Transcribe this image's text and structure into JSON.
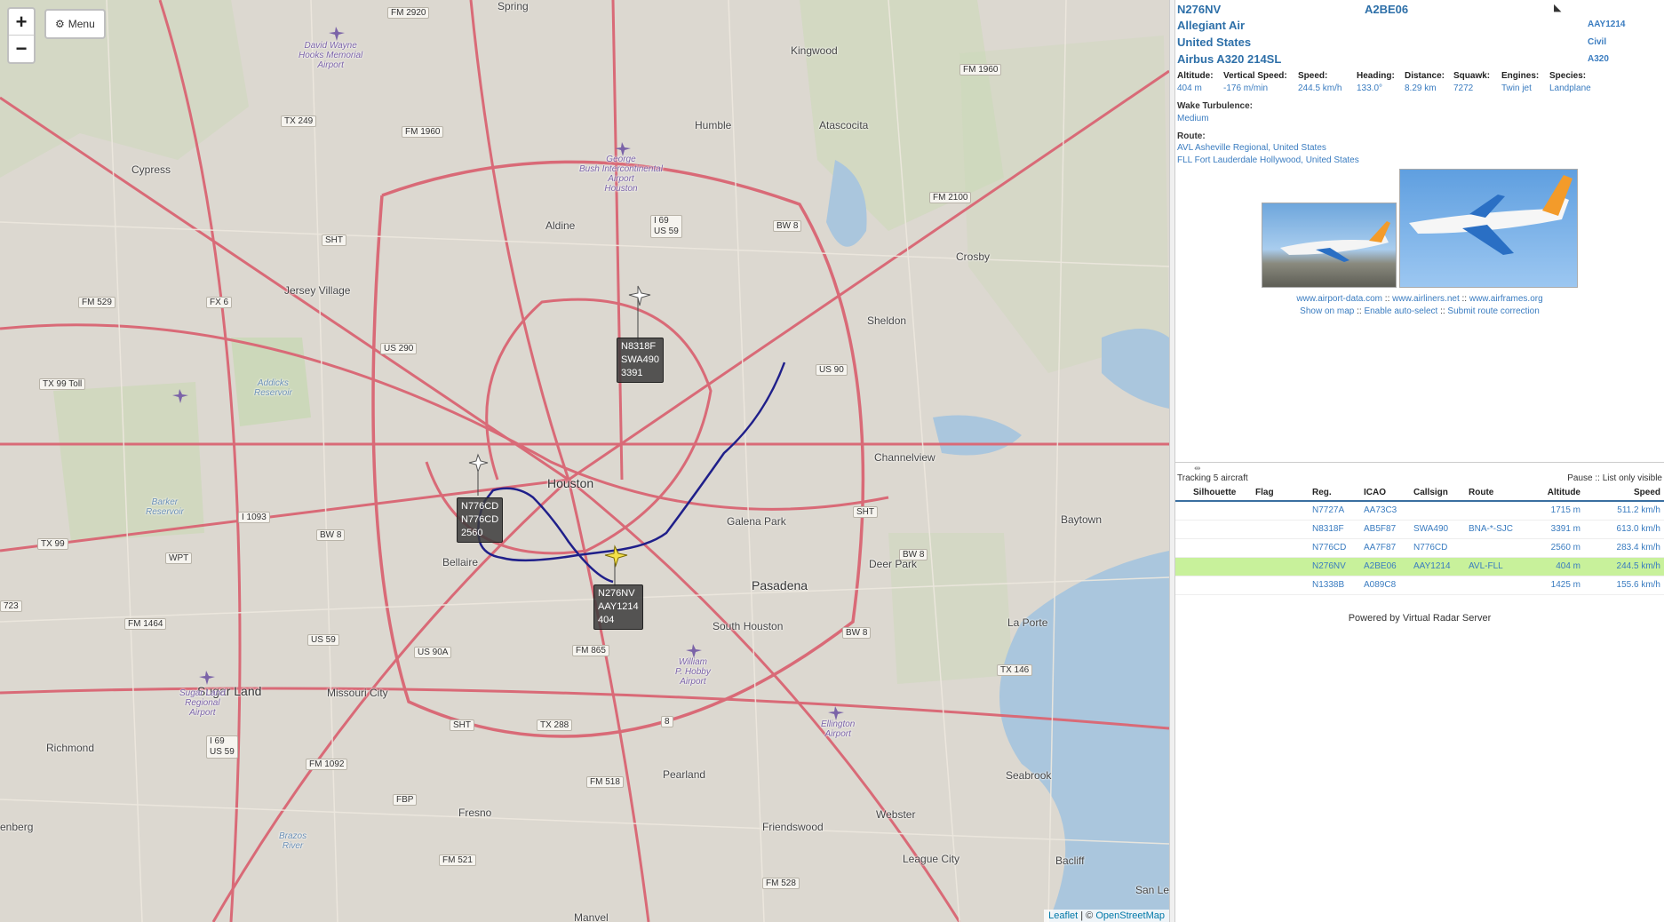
{
  "map": {
    "zoom_in": "+",
    "zoom_out": "−",
    "menu_label": "Menu",
    "attribution_leaflet": "Leaflet",
    "attribution_sep": " | © ",
    "attribution_osm": "OpenStreetMap",
    "places": {
      "houston": "Houston",
      "pasadena": "Pasadena",
      "sugar_land": "Sugar Land",
      "cypress": "Cypress",
      "jersey_village": "Jersey Village",
      "aldine": "Aldine",
      "humble": "Humble",
      "kingwood": "Kingwood",
      "atascocita": "Atascocita",
      "crosby": "Crosby",
      "sheldon": "Sheldon",
      "channelview": "Channelview",
      "galena_park": "Galena Park",
      "baytown": "Baytown",
      "deer_park": "Deer Park",
      "la_porte": "La Porte",
      "south_houston": "South Houston",
      "bellaire": "Bellaire",
      "missouri_city": "Missouri City",
      "richmond": "Richmond",
      "pearland": "Pearland",
      "fresno": "Fresno",
      "friendswood": "Friendswood",
      "webster": "Webster",
      "league_city": "League City",
      "seabrook": "Seabrook",
      "bacliff": "Bacliff",
      "spring": "Spring",
      "manvel": "Manvel",
      "san_leon": "San Leo",
      "enberg": "enberg"
    },
    "airports": {
      "hooks": "David Wayne\nHooks Memorial\nAirport",
      "iah": "George\nBush Intercontinental\nAirport\nHouston",
      "hobby": "William\nP. Hobby\nAirport",
      "ellington": "Ellington\nAirport",
      "sugar_land": "Sugar Land\nRegional\nAirport"
    },
    "water": {
      "addicks": "Addicks\nReservoir",
      "barker": "Barker\nReservoir",
      "brazos": "Brazos\nRiver"
    },
    "shields": [
      "FM 2920",
      "FM 1960",
      "TX 249",
      "FM 1960",
      "US 290",
      "FM 529",
      "FX 6",
      "TX 99 Toll",
      "SHT",
      "I 69\nUS 59",
      "BW 8",
      "US 90",
      "FM 2100",
      "SHT",
      "BW 8",
      "I 1093",
      "TX 99",
      "WPT",
      "BW 8",
      "US 59",
      "US 90A",
      "FM 1464",
      "FM 865",
      "SHT",
      "TX 288",
      "8",
      "FM 518",
      "FM 1092",
      "I 69\nUS 59",
      "FBP",
      "FM 521",
      "FM 528",
      "BW 8",
      "TX 146",
      "723"
    ],
    "aircraft_labels": [
      {
        "reg": "N8318F",
        "callsign": "SWA490",
        "alt": "3391"
      },
      {
        "reg": "N776CD",
        "callsign": "N776CD",
        "alt": "2560"
      },
      {
        "reg": "N276NV",
        "callsign": "AAY1214",
        "alt": "404"
      }
    ]
  },
  "detail": {
    "registration": "N276NV",
    "icao": "A2BE06",
    "operator": "Allegiant Air",
    "operator_code": "AAY1214",
    "country": "United States",
    "category": "Civil",
    "model": "Airbus A320 214SL",
    "model_code": "A320",
    "stats": [
      {
        "label": "Altitude:",
        "value": "404 m"
      },
      {
        "label": "Vertical Speed:",
        "value": "-176 m/min"
      },
      {
        "label": "Speed:",
        "value": "244.5 km/h"
      },
      {
        "label": "Heading:",
        "value": "133.0°"
      },
      {
        "label": "Distance:",
        "value": "8.29 km"
      },
      {
        "label": "Squawk:",
        "value": "7272"
      },
      {
        "label": "Engines:",
        "value": "Twin jet"
      },
      {
        "label": "Species:",
        "value": "Landplane"
      }
    ],
    "wake_label": "Wake Turbulence:",
    "wake_value": "Medium",
    "route_label": "Route:",
    "route_from": "AVL Asheville Regional, United States",
    "route_to": "FLL Fort Lauderdale Hollywood, United States",
    "links_line1": {
      "a": "www.airport-data.com",
      "sep1": " :: ",
      "b": "www.airliners.net",
      "sep2": " :: ",
      "c": "www.airframes.org"
    },
    "links_line2": {
      "a": "Show on map",
      "sep1": " :: ",
      "b": "Enable auto-select",
      "sep2": " :: ",
      "c": "Submit route correction"
    }
  },
  "list": {
    "tracking": "Tracking 5 aircraft",
    "pause": "Pause",
    "sep": " :: ",
    "list_only_visible": "List only visible",
    "columns": [
      "Silhouette",
      "Flag",
      "Reg.",
      "ICAO",
      "Callsign",
      "Route",
      "Altitude",
      "Speed"
    ],
    "rows": [
      {
        "reg": "N7727A",
        "icao": "AA73C3",
        "callsign": "",
        "route": "",
        "alt": "1715 m",
        "speed": "511.2 km/h",
        "selected": false
      },
      {
        "reg": "N8318F",
        "icao": "AB5F87",
        "callsign": "SWA490",
        "route": "BNA-*-SJC",
        "alt": "3391 m",
        "speed": "613.0 km/h",
        "selected": false
      },
      {
        "reg": "N776CD",
        "icao": "AA7F87",
        "callsign": "N776CD",
        "route": "",
        "alt": "2560 m",
        "speed": "283.4 km/h",
        "selected": false
      },
      {
        "reg": "N276NV",
        "icao": "A2BE06",
        "callsign": "AAY1214",
        "route": "AVL-FLL",
        "alt": "404 m",
        "speed": "244.5 km/h",
        "selected": true
      },
      {
        "reg": "N1338B",
        "icao": "A089C8",
        "callsign": "",
        "route": "",
        "alt": "1425 m",
        "speed": "155.6 km/h",
        "selected": false
      }
    ],
    "powered_by": "Powered by Virtual Radar Server"
  }
}
